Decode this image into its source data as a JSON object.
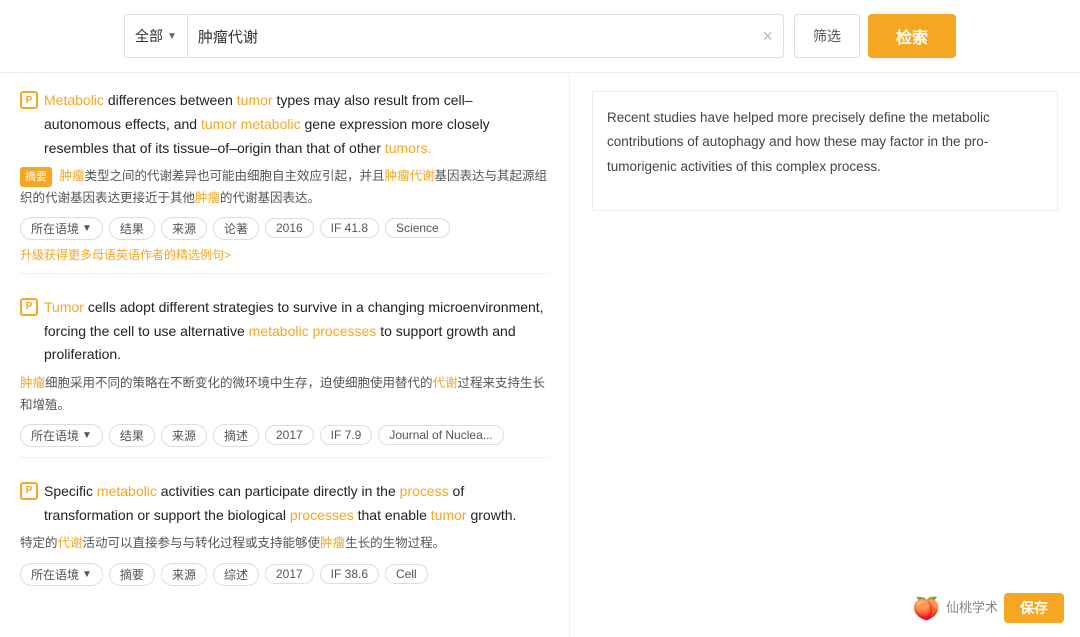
{
  "search": {
    "category": "全部",
    "category_chevron": "▼",
    "query": "肿瘤代谢",
    "clear_icon": "×",
    "filter_label": "筛选",
    "search_label": "检索"
  },
  "right_panel": {
    "text": "Recent studies have helped more precisely define the metabolic contributions of autophagy and how these may factor in the pro-tumorigenic activities of this complex process."
  },
  "results": [
    {
      "id": 1,
      "en_parts": [
        {
          "text": "Metabolic",
          "type": "orange"
        },
        {
          "text": " differences between ",
          "type": "normal"
        },
        {
          "text": "tumor",
          "type": "orange"
        },
        {
          "text": " types may also result from cell–autonomous effects, and ",
          "type": "normal"
        },
        {
          "text": "tumor",
          "type": "orange"
        },
        {
          "text": " ",
          "type": "normal"
        },
        {
          "text": "metabolic",
          "type": "orange"
        },
        {
          "text": " gene expression more closely resembles that of its tissue–of–origin than that of other ",
          "type": "normal"
        },
        {
          "text": "tumors.",
          "type": "orange"
        }
      ],
      "cn_badge": "摘要",
      "cn_text": "肿瘤类型之间的代谢差异也可能由细胞自主效应引起，并且肿瘤代谢基因表达与其起源组织的代谢基因表达更接近于其他肿瘤的代谢基因表达。",
      "cn_highlights": [
        "肿瘤",
        "肿瘤代谢",
        "肿瘤"
      ],
      "tags": [
        "所在语境",
        "结果",
        "来源",
        "论著",
        "2016",
        "IF 41.8",
        "Science"
      ],
      "tag_dropdown": [
        "所在语境"
      ],
      "upgrade_text": "升级获得更多母语英语作者的精选例句>"
    },
    {
      "id": 2,
      "en_parts": [
        {
          "text": "Tumor",
          "type": "orange"
        },
        {
          "text": " cells adopt different strategies to survive in a changing microenvironment, forcing the cell to use alternative ",
          "type": "normal"
        },
        {
          "text": "metabolic processes",
          "type": "orange"
        },
        {
          "text": " to support growth and proliferation.",
          "type": "normal"
        }
      ],
      "cn_badge": null,
      "cn_text": "肿瘤细胞采用不同的策略在不断变化的微环境中生存，迫使细胞使用替代的代谢过程来支持生长和增殖。",
      "cn_highlights": [
        "肿瘤",
        "代谢"
      ],
      "tags": [
        "所在语境",
        "结果",
        "来源",
        "摘述",
        "2017",
        "IF 7.9",
        "Journal of Nuclea..."
      ],
      "tag_dropdown": [
        "所在语境"
      ],
      "upgrade_text": null
    },
    {
      "id": 3,
      "en_parts": [
        {
          "text": "Specific ",
          "type": "normal"
        },
        {
          "text": "metabolic",
          "type": "orange"
        },
        {
          "text": " activities can participate directly in the ",
          "type": "normal"
        },
        {
          "text": "process",
          "type": "orange"
        },
        {
          "text": " of transformation or support the biological ",
          "type": "normal"
        },
        {
          "text": "processes",
          "type": "orange"
        },
        {
          "text": " that enable ",
          "type": "normal"
        },
        {
          "text": "tumor",
          "type": "orange"
        },
        {
          "text": " growth.",
          "type": "normal"
        }
      ],
      "cn_badge": null,
      "cn_text": "特定的代谢活动可以直接参与与转化过程或支持能够使肿瘤生长的生物过程。",
      "cn_highlights": [
        "代谢",
        "肿瘤"
      ],
      "tags": [
        "所在语境",
        "摘要",
        "来源",
        "综述",
        "2017",
        "IF 38.6",
        "Cell"
      ],
      "tag_dropdown": [
        "所在语境"
      ],
      "upgrade_text": null
    }
  ],
  "branding": {
    "logo_text": "仙桃学术",
    "save_label": "保存"
  }
}
